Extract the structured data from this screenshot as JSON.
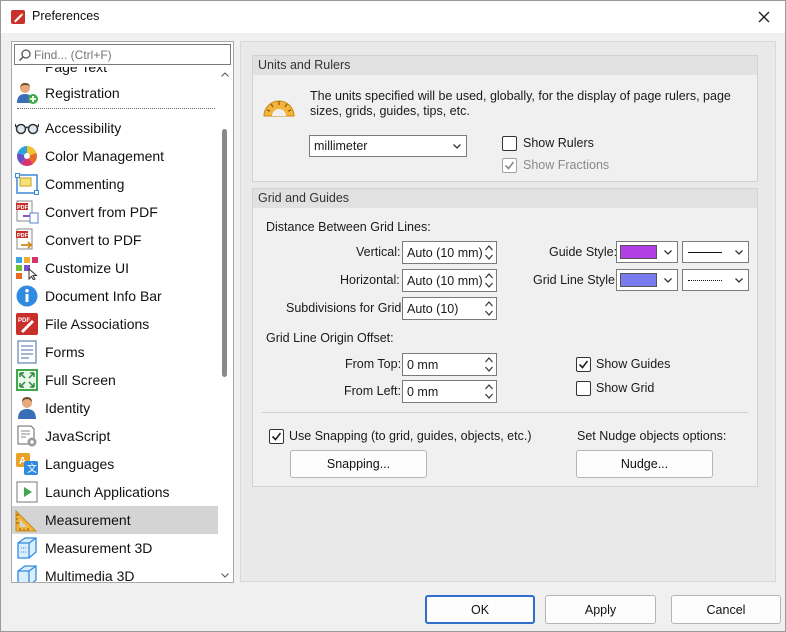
{
  "window": {
    "title": "Preferences",
    "close_icon": "close-icon"
  },
  "search": {
    "placeholder": "Find... (Ctrl+F)"
  },
  "sidebar": {
    "partial_item": "Page Text",
    "items": [
      {
        "label": "Registration",
        "icon": "registration-icon"
      },
      {
        "label": "Accessibility",
        "icon": "glasses-icon"
      },
      {
        "label": "Color Management",
        "icon": "color-wheel-icon"
      },
      {
        "label": "Commenting",
        "icon": "comment-icon"
      },
      {
        "label": "Convert from PDF",
        "icon": "convert-from-pdf-icon"
      },
      {
        "label": "Convert to PDF",
        "icon": "convert-to-pdf-icon"
      },
      {
        "label": "Customize UI",
        "icon": "customize-ui-icon"
      },
      {
        "label": "Document Info Bar",
        "icon": "info-icon"
      },
      {
        "label": "File Associations",
        "icon": "pdf-file-icon"
      },
      {
        "label": "Forms",
        "icon": "forms-icon"
      },
      {
        "label": "Full Screen",
        "icon": "full-screen-icon"
      },
      {
        "label": "Identity",
        "icon": "identity-icon"
      },
      {
        "label": "JavaScript",
        "icon": "javascript-icon"
      },
      {
        "label": "Languages",
        "icon": "languages-icon"
      },
      {
        "label": "Launch Applications",
        "icon": "launch-applications-icon"
      },
      {
        "label": "Measurement",
        "icon": "measurement-icon",
        "selected": true
      },
      {
        "label": "Measurement 3D",
        "icon": "measurement-3d-icon"
      },
      {
        "label": "Multimedia 3D",
        "icon": "multimedia-3d-icon"
      }
    ]
  },
  "units_rulers": {
    "header": "Units and Rulers",
    "description": "The units specified will be used, globally, for the display of page rulers, page sizes, grids, guides, tips, etc.",
    "unit_value": "millimeter",
    "show_rulers_label": "Show Rulers",
    "show_rulers_checked": false,
    "show_fractions_label": "Show Fractions",
    "show_fractions_checked": true,
    "show_fractions_disabled": true
  },
  "grid_guides": {
    "header": "Grid and Guides",
    "distance_label": "Distance Between Grid Lines:",
    "vertical_label": "Vertical:",
    "vertical_value": "Auto (10 mm)",
    "horizontal_label": "Horizontal:",
    "horizontal_value": "Auto (10 mm)",
    "subdivisions_label": "Subdivisions for Grid:",
    "subdivisions_value": "Auto (10)",
    "guide_style_label": "Guide Style:",
    "guide_color": "#b23ee6",
    "grid_line_style_label": "Grid Line Style:",
    "grid_line_color": "#7b7bf0",
    "origin_label": "Grid Line Origin Offset:",
    "from_top_label": "From Top:",
    "from_top_value": "0 mm",
    "from_left_label": "From Left:",
    "from_left_value": "0 mm",
    "show_guides_label": "Show Guides",
    "show_guides_checked": true,
    "show_grid_label": "Show Grid",
    "show_grid_checked": false,
    "use_snapping_label": "Use Snapping (to grid, guides, objects, etc.)",
    "use_snapping_checked": true,
    "snapping_button": "Snapping...",
    "nudge_label": "Set Nudge objects options:",
    "nudge_button": "Nudge..."
  },
  "footer": {
    "ok": "OK",
    "apply": "Apply",
    "cancel": "Cancel"
  }
}
